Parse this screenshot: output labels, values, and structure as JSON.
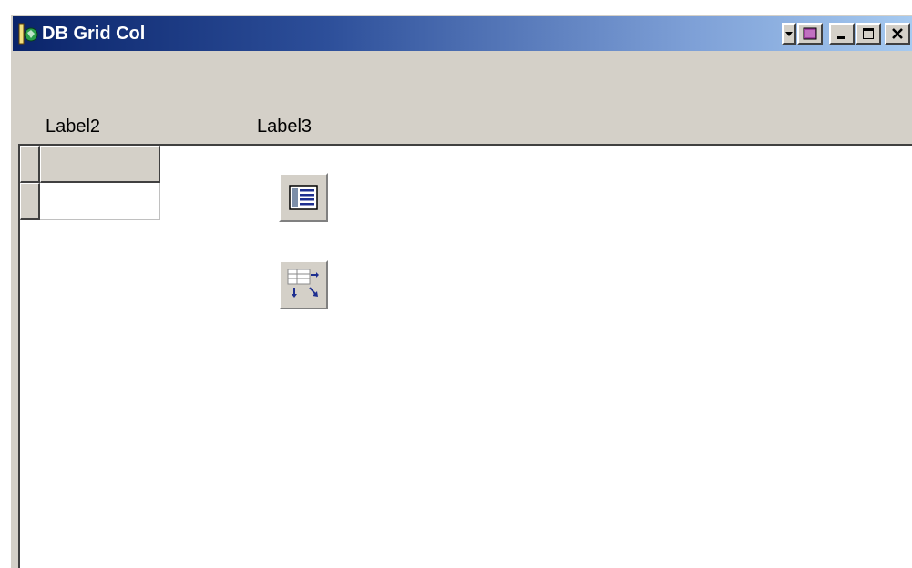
{
  "window": {
    "title": "DB Grid Col",
    "title_color": "#ffffff",
    "title_gradient": [
      "#0a246a",
      "#a6caf0"
    ],
    "face_color": "#d4d0c8",
    "icons": {
      "app": "delphi-app-icon",
      "system_menu": "system-menu-icon",
      "minimize": "minimize-icon",
      "maximize": "maximize-icon",
      "close": "close-icon"
    }
  },
  "form": {
    "label2": "Label2",
    "label3": "Label3"
  },
  "components": [
    {
      "name": "datasource-component",
      "icon": "datasource-icon"
    },
    {
      "name": "table-component",
      "icon": "table-icon"
    }
  ]
}
